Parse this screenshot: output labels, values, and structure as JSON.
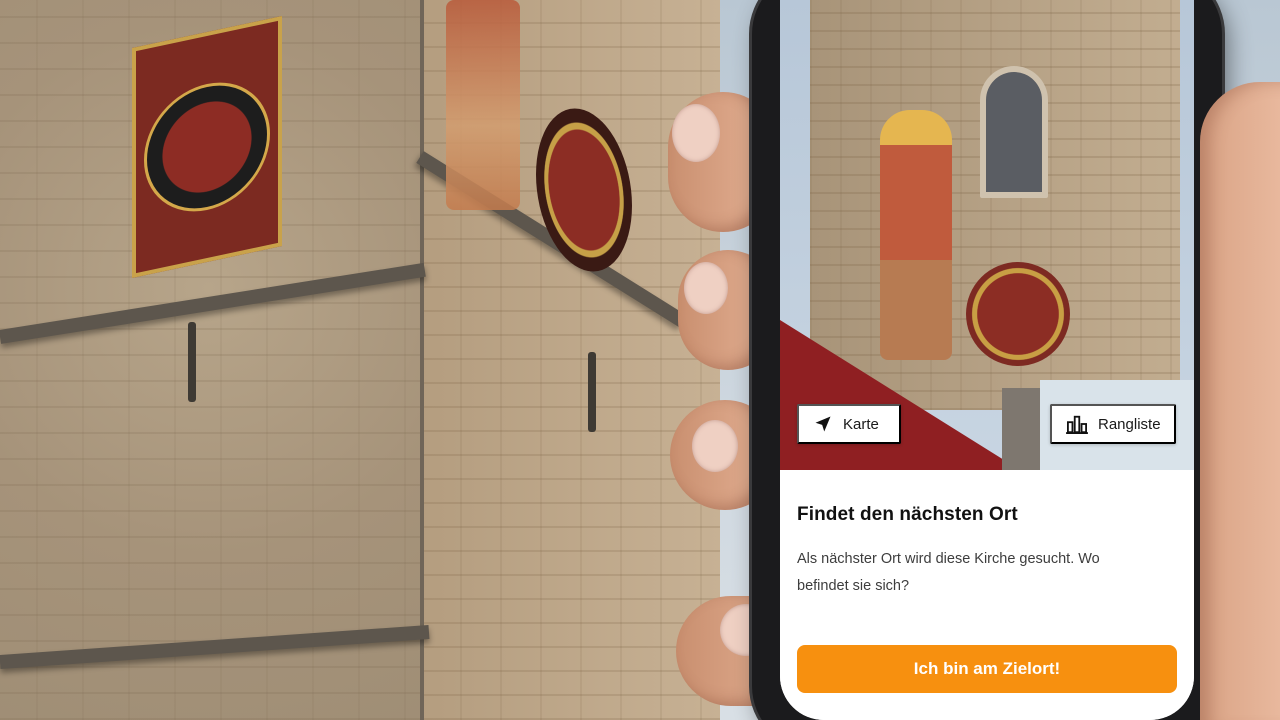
{
  "app": {
    "map_button_label": "Karte",
    "leaderboard_button_label": "Rangliste",
    "card": {
      "title": "Findet den nächsten Ort",
      "description": "Als nächster Ort wird diese Kirche gesucht. Wo befindet sie sich?"
    },
    "primary_button_label": "Ich bin am Zielort!"
  },
  "icons": {
    "map_button": "navigation-arrow-icon",
    "leaderboard_button": "bar-chart-icon"
  },
  "colors": {
    "accent": "#F7900F",
    "button_text": "#FFFFFF",
    "title_text": "#111111",
    "body_text": "#3D3D3D"
  }
}
